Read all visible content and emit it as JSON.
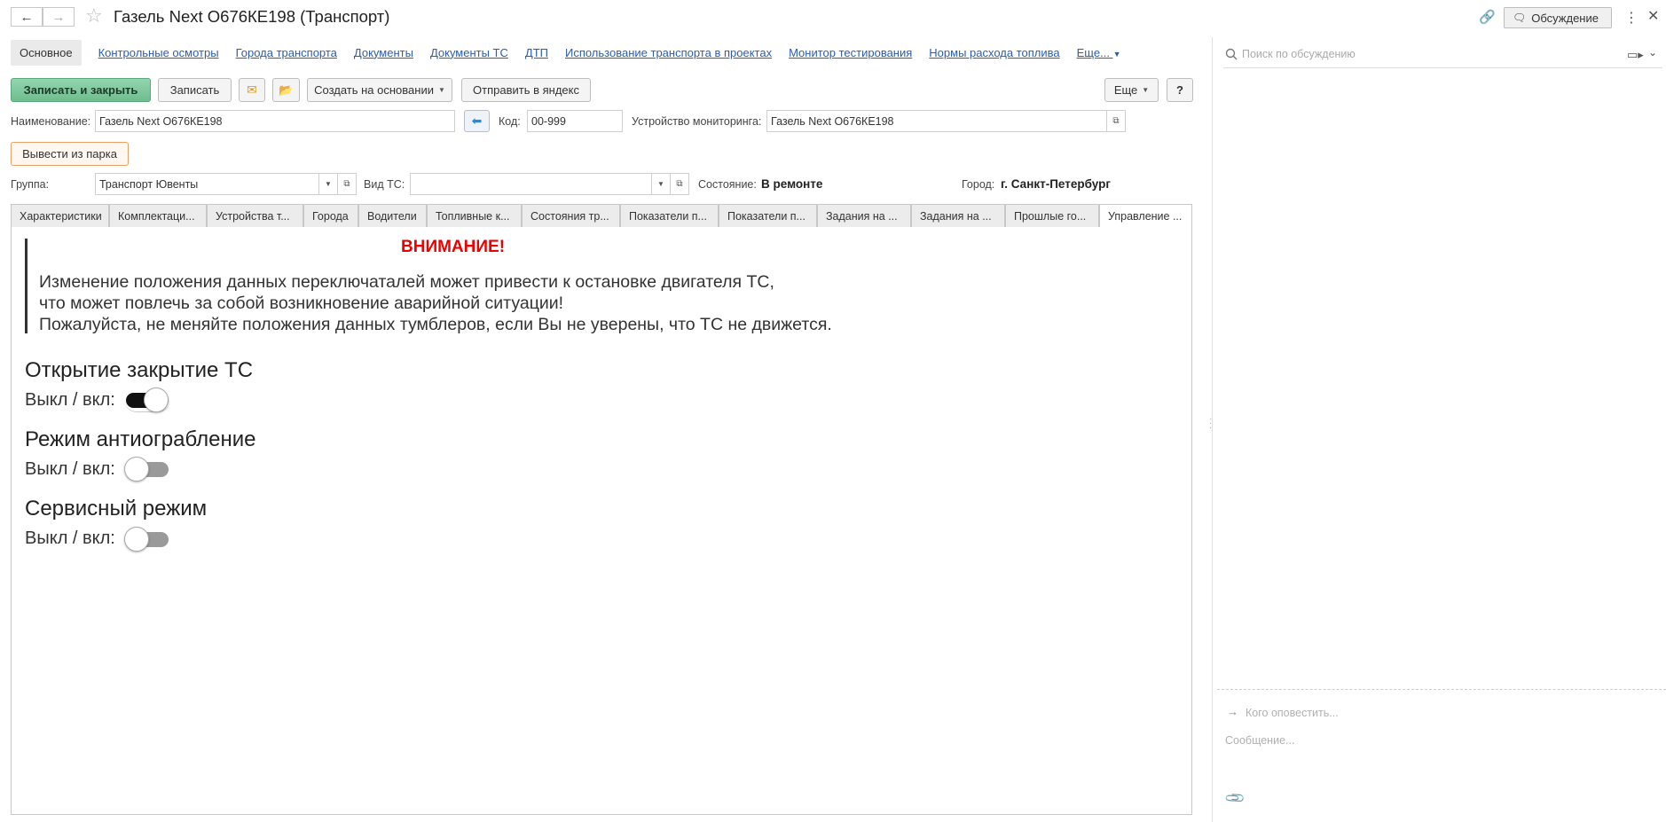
{
  "window": {
    "title": "Газель Next О676КЕ198 (Транспорт)",
    "back_icon": "arrow-left-icon",
    "forward_icon": "arrow-right-icon",
    "favorite_icon": "star-icon",
    "link_icon": "link-icon",
    "discussion_button": "Обсуждение",
    "more_icon": "vertical-dots-icon",
    "close_icon": "close-icon"
  },
  "sections": {
    "active": "Основное",
    "links": [
      "Контрольные осмотры",
      "Города транспорта",
      "Документы",
      "Документы ТС",
      "ДТП",
      "Использование транспорта в проектах",
      "Монитор тестирования",
      "Нормы расхода топлива"
    ],
    "more": "Еще..."
  },
  "toolbar": {
    "save_close": "Записать и закрыть",
    "save": "Записать",
    "mail_icon": "envelope-icon",
    "folder_icon": "folder-icon",
    "create_based": "Создать на основании",
    "send_yandex": "Отправить в яндекс",
    "more": "Еще",
    "help": "?"
  },
  "form": {
    "name_label": "Наименование:",
    "name_value": "Газель Next О676КЕ198",
    "code_label": "Код:",
    "code_value": "00-999",
    "device_label": "Устройство мониторинга:",
    "device_value": "Газель Next О676КЕ198",
    "remove_button": "Вывести из парка",
    "group_label": "Группа:",
    "group_value": "Транспорт Ювенты",
    "type_label": "Вид ТС:",
    "type_value": "",
    "state_label": "Состояние:",
    "state_value": "В ремонте",
    "city_label": "Город:",
    "city_value": "г. Санкт-Петербург"
  },
  "tabs": [
    "Характеристики",
    "Комплектаци...",
    "Устройства т...",
    "Города",
    "Водители",
    "Топливные к...",
    "Состояния тр...",
    "Показатели п...",
    "Показатели п...",
    "Задания на ...",
    "Задания на ...",
    "Прошлые го...",
    "Управление ..."
  ],
  "control": {
    "warning_title": "ВНИМАНИЕ!",
    "warning_line1": "Изменение положения данных переключаталей может привести к остановке двигателя ТС,",
    "warning_line2": "что может повлечь за собой возникновение аварийной ситуации!",
    "warning_line3": "Пожалуйста, не меняйте положения данных тумблеров, если Вы не уверены, что ТС не движется.",
    "switches": [
      {
        "title": "Открытие закрытие ТС",
        "label": "Выкл / вкл:",
        "on": true
      },
      {
        "title": "Режим антиограбление",
        "label": "Выкл / вкл:",
        "on": false
      },
      {
        "title": "Сервисный режим",
        "label": "Выкл / вкл:",
        "on": false
      }
    ]
  },
  "discussion": {
    "search_placeholder": "Поиск по обсуждению",
    "notify_placeholder": "Кого оповестить...",
    "message_placeholder": "Сообщение...",
    "attach_icon": "paperclip-icon"
  },
  "colors": {
    "link": "#2a5db0",
    "primary_button": "#78c79a",
    "warning": "#e00000"
  }
}
